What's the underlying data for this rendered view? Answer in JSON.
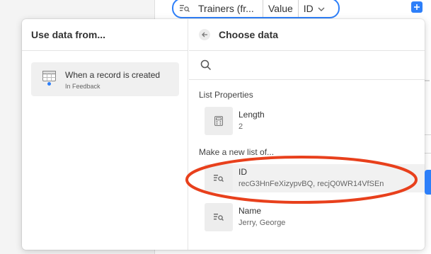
{
  "colors": {
    "accent": "#2d7ff9",
    "annotation_red": "#e8401c"
  },
  "token": {
    "name": "Trainers (fr...",
    "field": "Value",
    "type": "ID",
    "icon": "list-lookup-icon",
    "chevron": "chevron-down-icon"
  },
  "left_pane": {
    "title": "Use data from...",
    "source": {
      "title": "When a record is created",
      "subtitle": "In Feedback",
      "icon": "table-trigger-icon"
    }
  },
  "right_pane": {
    "title": "Choose data",
    "back_icon": "arrow-left-icon",
    "search": {
      "placeholder": "",
      "value": "",
      "icon": "search-icon"
    },
    "list_properties_label": "List Properties",
    "length_item": {
      "title": "Length",
      "value": "2",
      "icon": "calculator-icon"
    },
    "make_list_label": "Make a new list of...",
    "fields": [
      {
        "title": "ID",
        "value": "recG3HnFeXizypvBQ, recjQ0WR14VfSEn",
        "icon": "list-lookup-icon"
      },
      {
        "title": "Name",
        "value": "Jerry, George",
        "icon": "list-lookup-icon"
      }
    ]
  }
}
